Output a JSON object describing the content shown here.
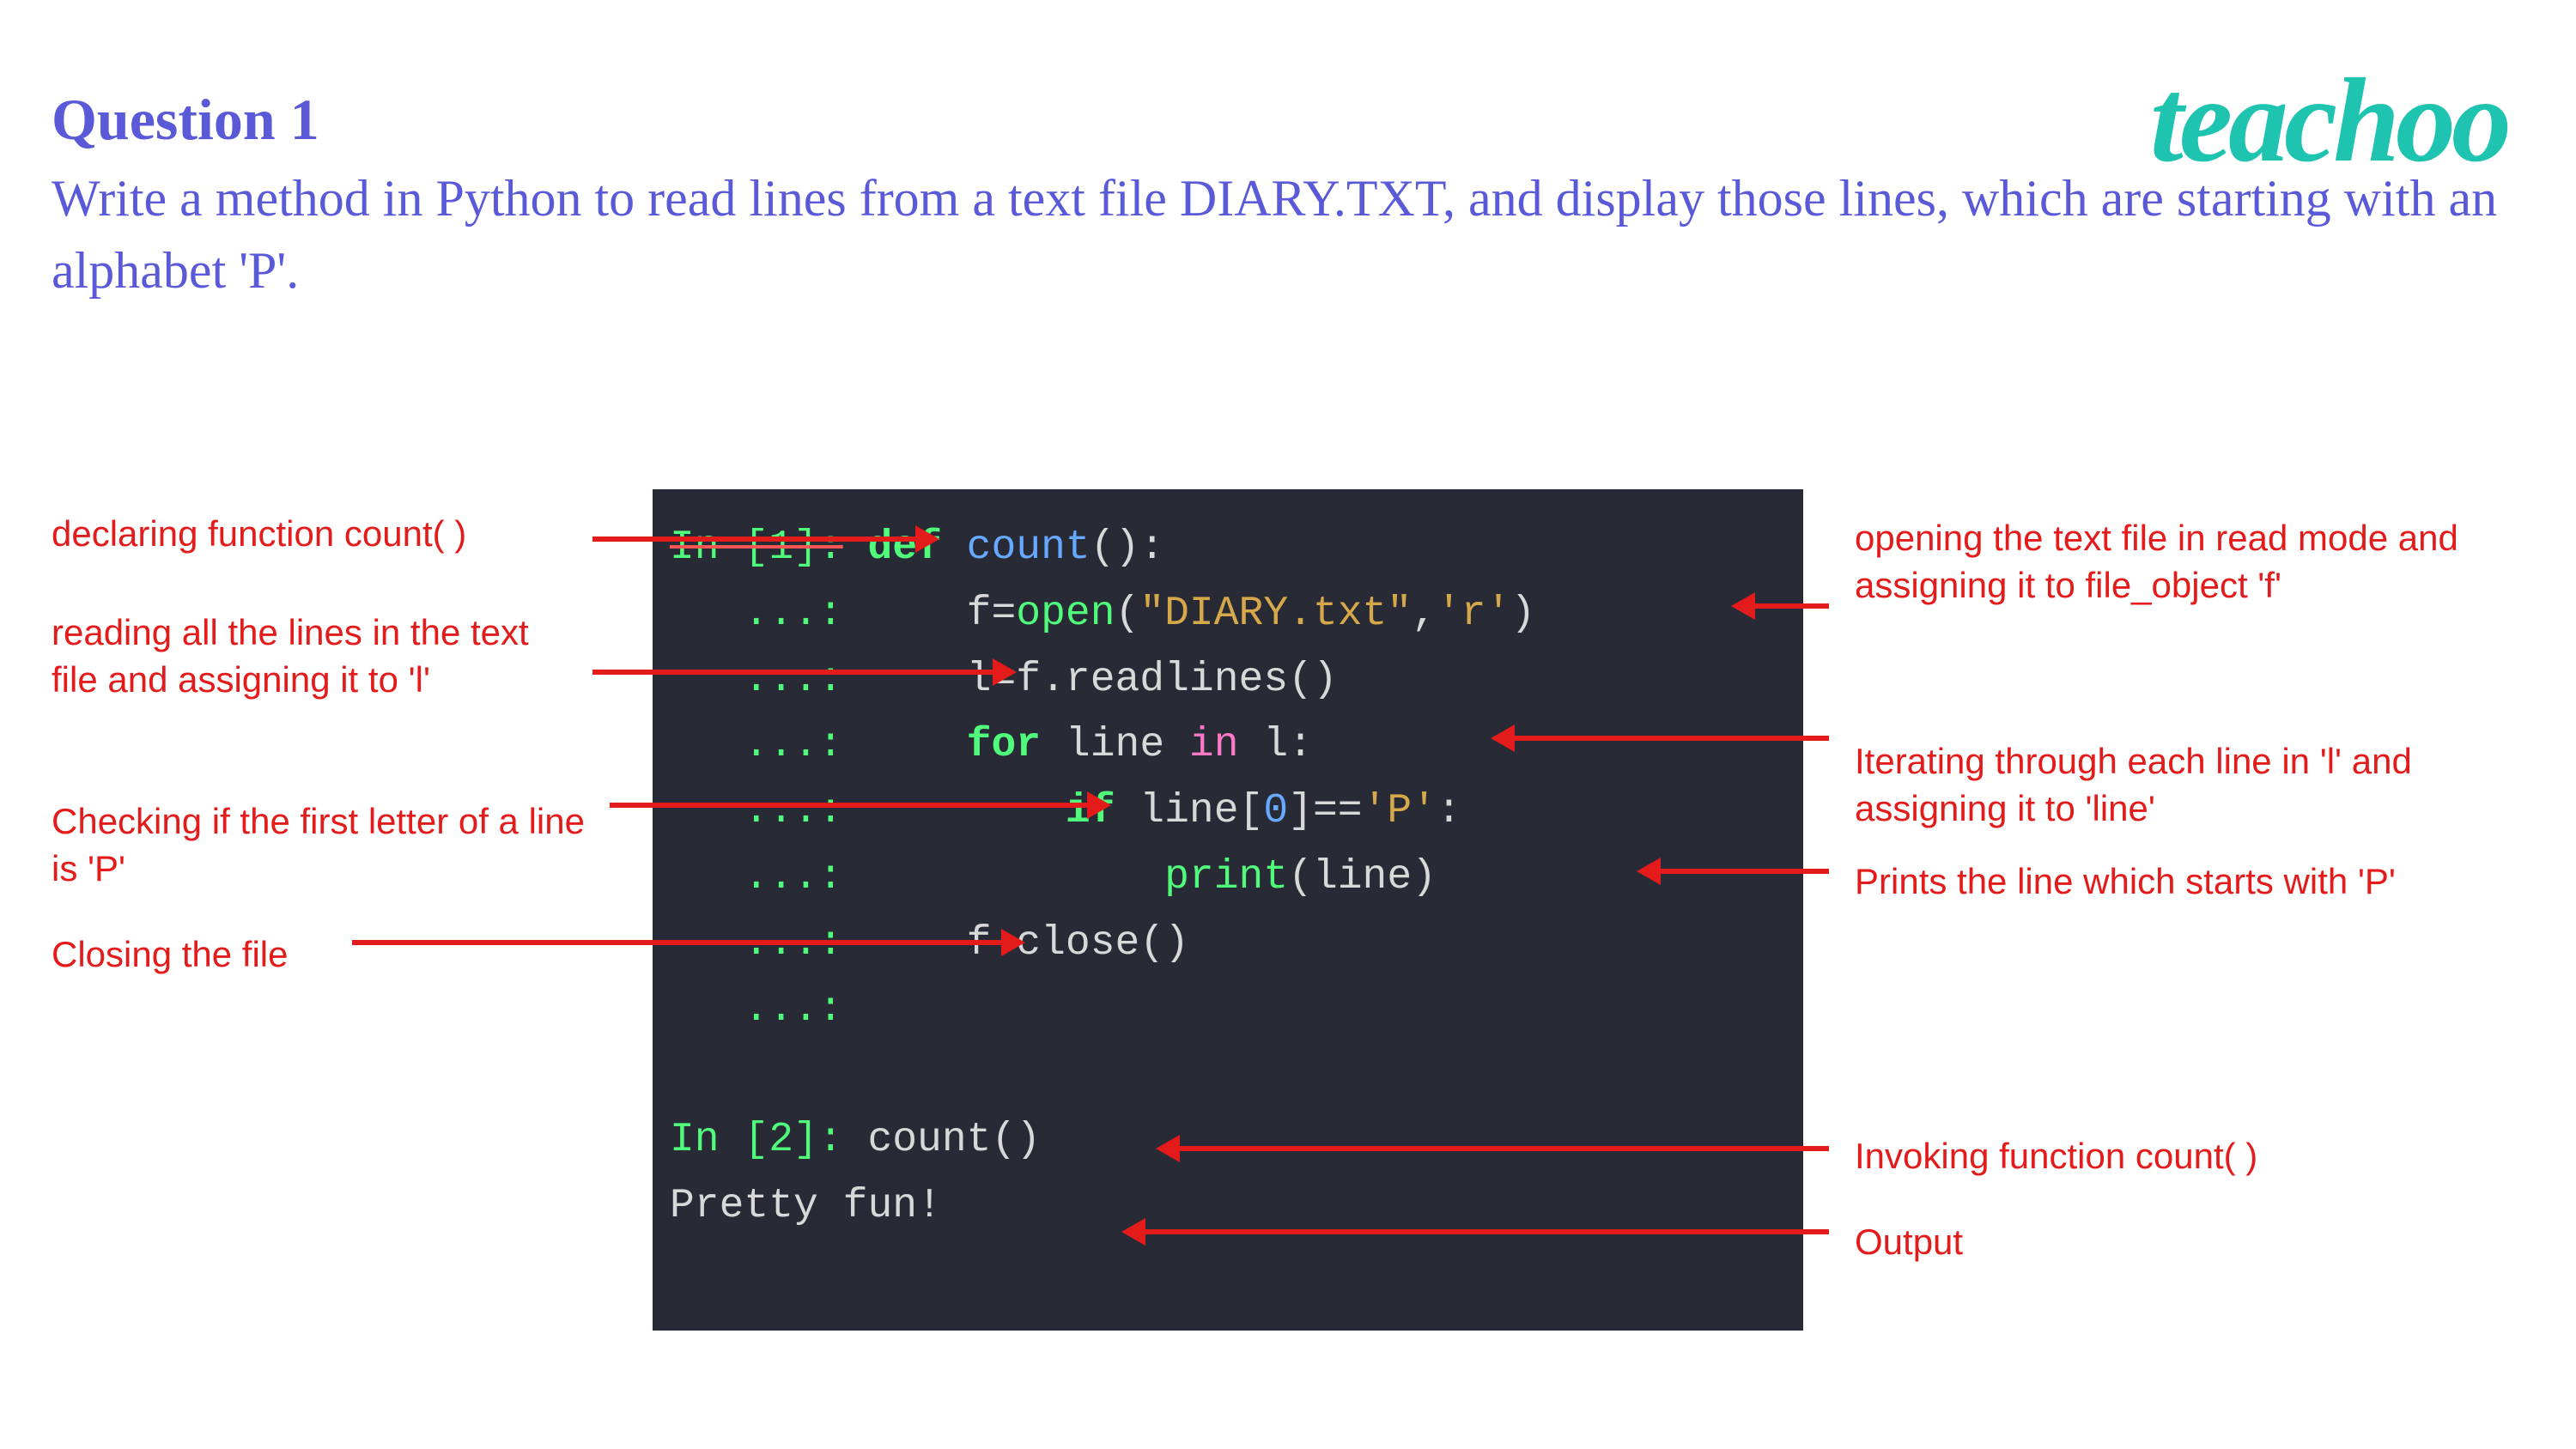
{
  "logo": "teachoo",
  "question_number": "Question 1",
  "question_text": "Write a method in Python to read lines from a text  file DIARY.TXT, and display those lines, which  are starting with an alphabet 'P'.",
  "code": {
    "line1_prompt": "In [1]:",
    "line1_body": " def count():",
    "line2_prompt": "   ...:",
    "line2_body": "     f=open(\"DIARY.txt\",'r')",
    "line3_prompt": "   ...:",
    "line3_body": "     l=f.readlines()",
    "line4_prompt": "   ...:",
    "line4_body": "     for line in l:",
    "line5_prompt": "   ...:",
    "line5_body": "         if line[0]=='P':",
    "line6_prompt": "   ...:",
    "line6_body": "             print(line)",
    "line7_prompt": "   ...:",
    "line7_body": "     f.close()",
    "line8_prompt": "   ...:",
    "line9_prompt": "In [2]:",
    "line9_body": " count()",
    "line10": "Pretty fun!"
  },
  "annotations": {
    "left1": "declaring function count( )",
    "left2": "reading all the lines in the text file and assigning it to 'l'",
    "left3": "Checking if the first letter of a line is 'P'",
    "left4": "Closing the file",
    "right1": "opening the text file in read mode and assigning it to file_object 'f'",
    "right2": "Iterating through each line in 'l' and assigning it to 'line'",
    "right3": "Prints the line which starts with 'P'",
    "right4": "Invoking function count( )",
    "right5": "Output"
  }
}
